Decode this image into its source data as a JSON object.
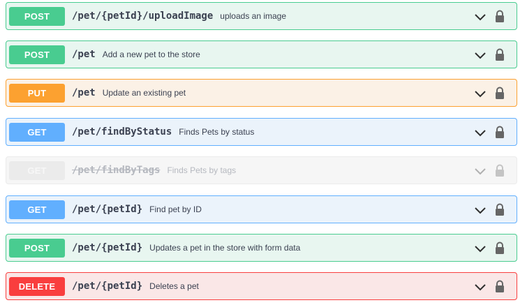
{
  "operations": [
    {
      "method": "POST",
      "path": "/pet/{petId}/uploadImage",
      "summary": "uploads an image"
    },
    {
      "method": "POST",
      "path": "/pet",
      "summary": "Add a new pet to the store"
    },
    {
      "method": "PUT",
      "path": "/pet",
      "summary": "Update an existing pet"
    },
    {
      "method": "GET",
      "path": "/pet/findByStatus",
      "summary": "Finds Pets by status"
    },
    {
      "method": "GET",
      "path": "/pet/findByTags",
      "summary": "Finds Pets by tags",
      "deprecated": true
    },
    {
      "method": "GET",
      "path": "/pet/{petId}",
      "summary": "Find pet by ID"
    },
    {
      "method": "POST",
      "path": "/pet/{petId}",
      "summary": "Updates a pet in the store with form data"
    },
    {
      "method": "DELETE",
      "path": "/pet/{petId}",
      "summary": "Deletes a pet"
    }
  ],
  "icons": {
    "expand": "chevron-down-icon",
    "auth": "lock-icon"
  },
  "colors": {
    "post": "#49cc90",
    "put": "#fca130",
    "get": "#61affe",
    "delete": "#f93e3e",
    "deprecated": "#ebebeb"
  }
}
